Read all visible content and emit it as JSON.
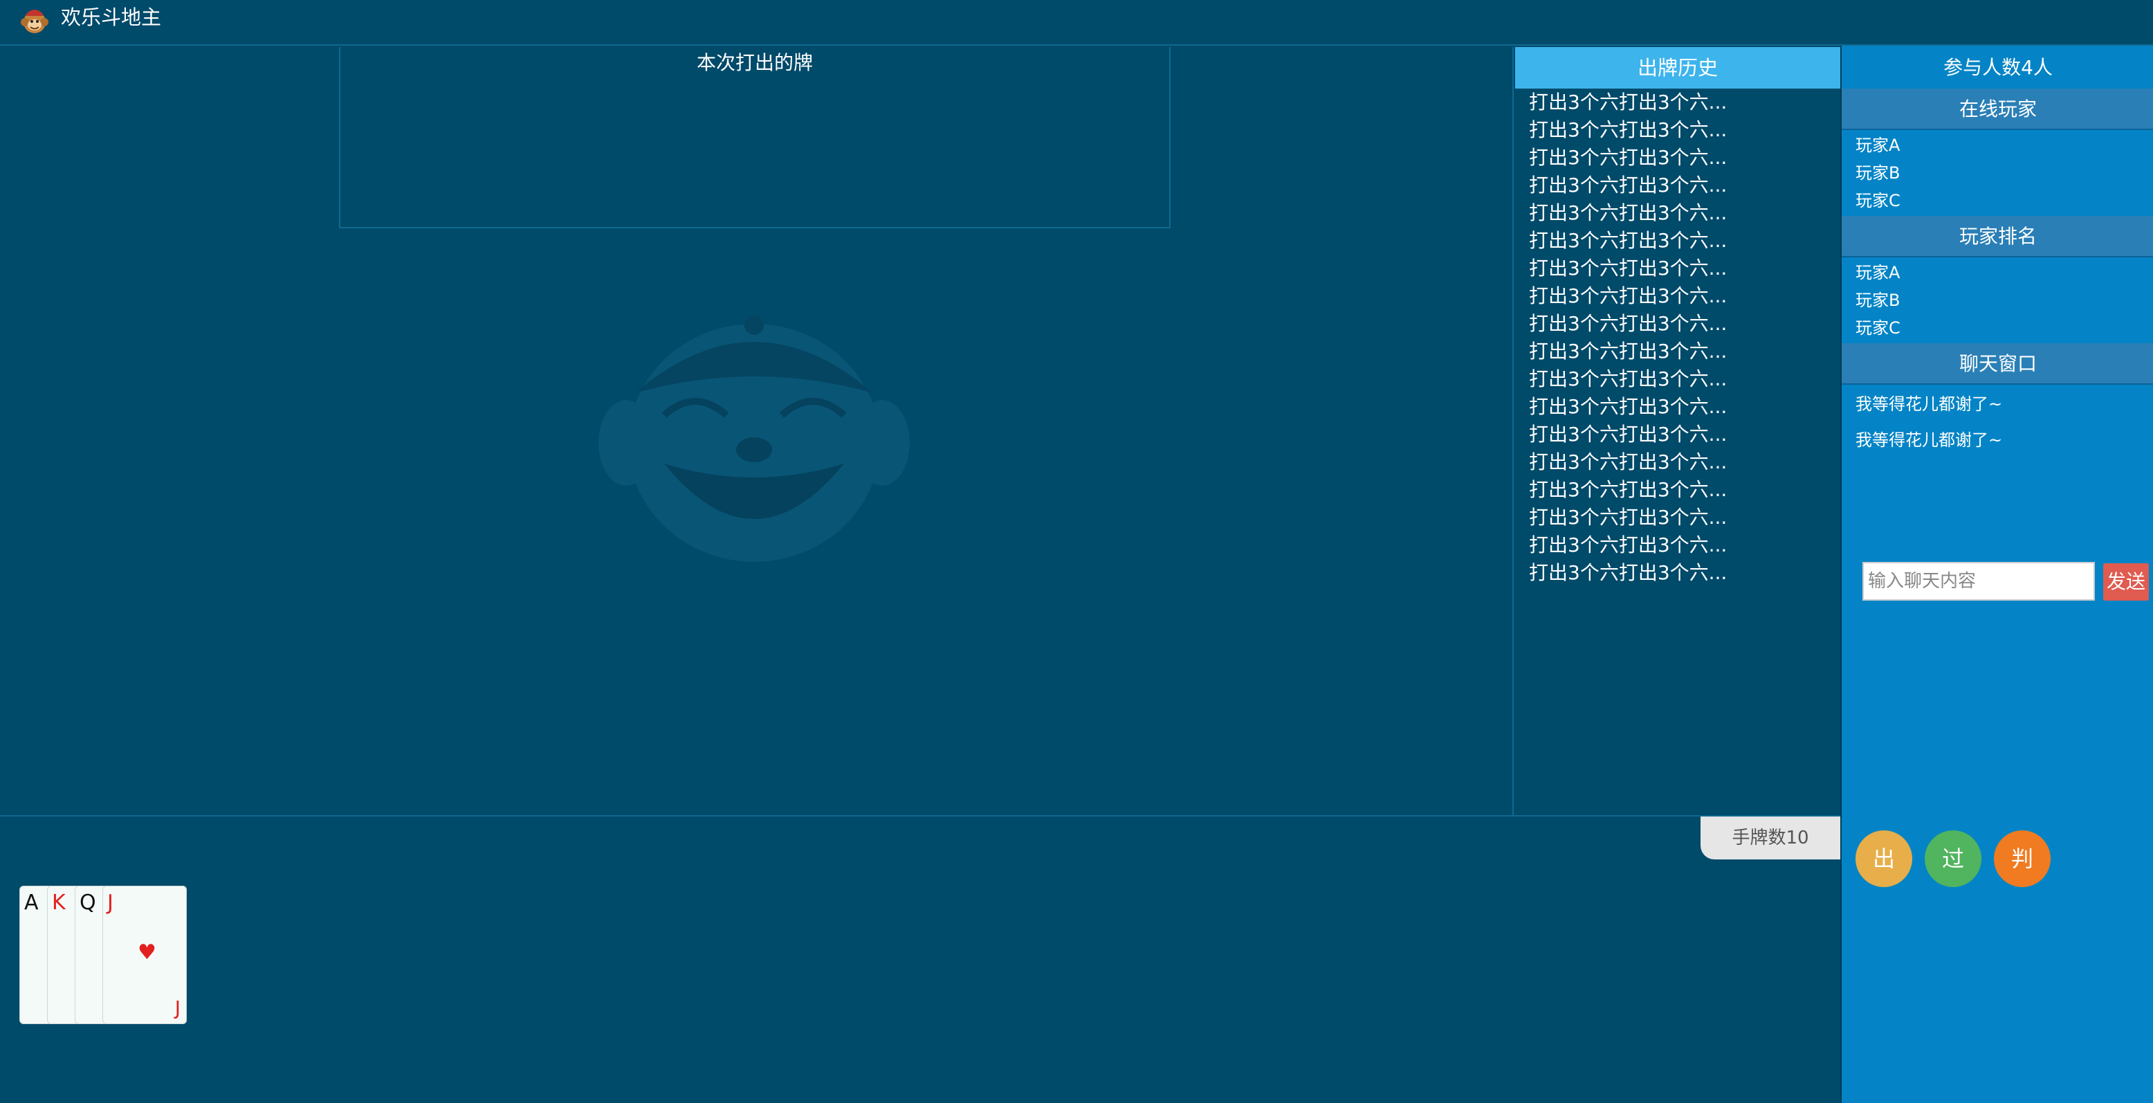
{
  "header": {
    "title": "欢乐斗地主",
    "logo_icon": "monkey-logo-icon"
  },
  "played_area": {
    "label": "本次打出的牌"
  },
  "history": {
    "title": "出牌历史",
    "items": [
      "打出3个六打出3个六...",
      "打出3个六打出3个六...",
      "打出3个六打出3个六...",
      "打出3个六打出3个六...",
      "打出3个六打出3个六...",
      "打出3个六打出3个六...",
      "打出3个六打出3个六...",
      "打出3个六打出3个六...",
      "打出3个六打出3个六...",
      "打出3个六打出3个六...",
      "打出3个六打出3个六...",
      "打出3个六打出3个六...",
      "打出3个六打出3个六...",
      "打出3个六打出3个六...",
      "打出3个六打出3个六...",
      "打出3个六打出3个六...",
      "打出3个六打出3个六...",
      "打出3个六打出3个六..."
    ]
  },
  "side": {
    "participants": "参与人数4人",
    "online_title": "在线玩家",
    "online_players": [
      "玩家A",
      "玩家B",
      "玩家C"
    ],
    "ranking_title": "玩家排名",
    "ranking_players": [
      "玩家A",
      "玩家B",
      "玩家C"
    ],
    "chat_title": "聊天窗口",
    "chat_messages": [
      "我等得花儿都谢了~",
      "我等得花儿都谢了~"
    ],
    "chat_placeholder": "输入聊天内容",
    "send_label": "发送"
  },
  "actions": {
    "play": "出",
    "pass": "过",
    "judge": "判"
  },
  "hand": {
    "count_label": "手牌数10",
    "cards": [
      {
        "rank": "A",
        "color": "black"
      },
      {
        "rank": "K",
        "color": "red"
      },
      {
        "rank": "Q",
        "color": "black"
      },
      {
        "rank": "J",
        "color": "red",
        "suit": "♥"
      }
    ]
  },
  "colors": {
    "background": "#004a6a",
    "side_panel": "#0484c6",
    "history_header": "#3db4ec",
    "send_button": "#e05b50",
    "play_button": "#e7ae4a",
    "pass_button": "#51b45e",
    "judge_button": "#f07b21"
  }
}
